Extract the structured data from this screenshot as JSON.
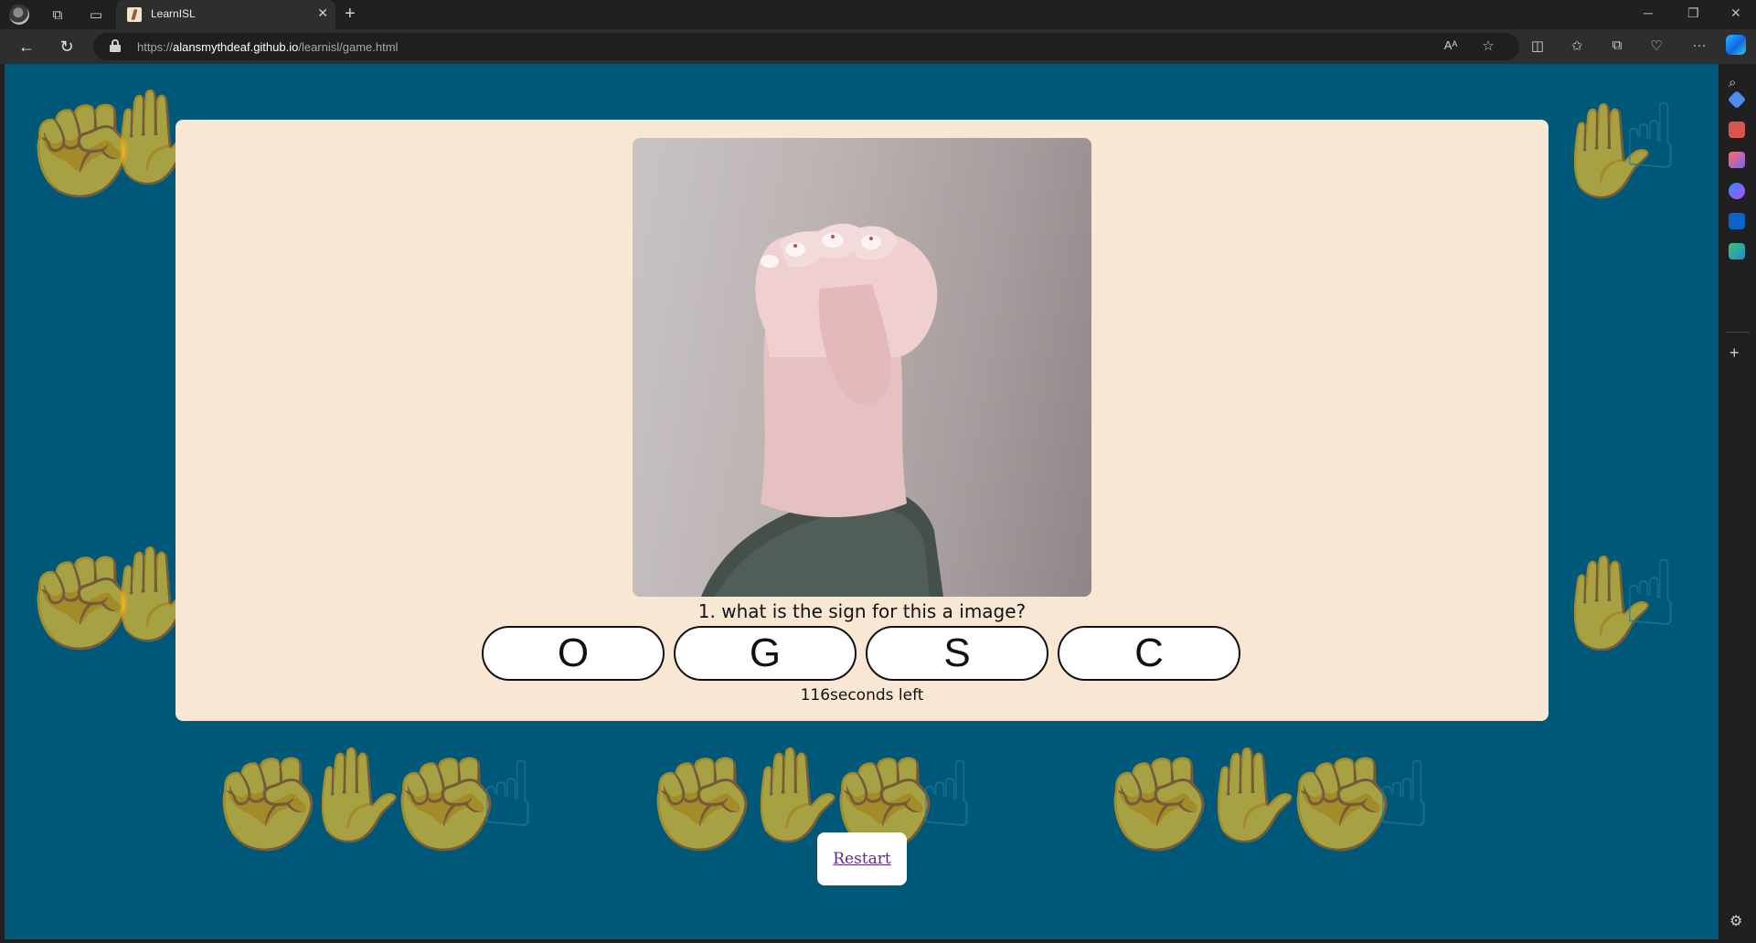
{
  "browser": {
    "tab_title": "LearnISL",
    "url_prefix": "https://",
    "url_domain": "alansmythdeaf.github.io",
    "url_path": "/learnisl/game.html"
  },
  "quiz": {
    "question": "1. what is the sign for this a image?",
    "options": [
      "O",
      "G",
      "S",
      "C"
    ],
    "timer_text": "116seconds left",
    "restart_label": "Restart"
  },
  "colors": {
    "page_background": "#005878",
    "card_background": "#f8e8d3",
    "restart_link": "#5b2d84"
  }
}
